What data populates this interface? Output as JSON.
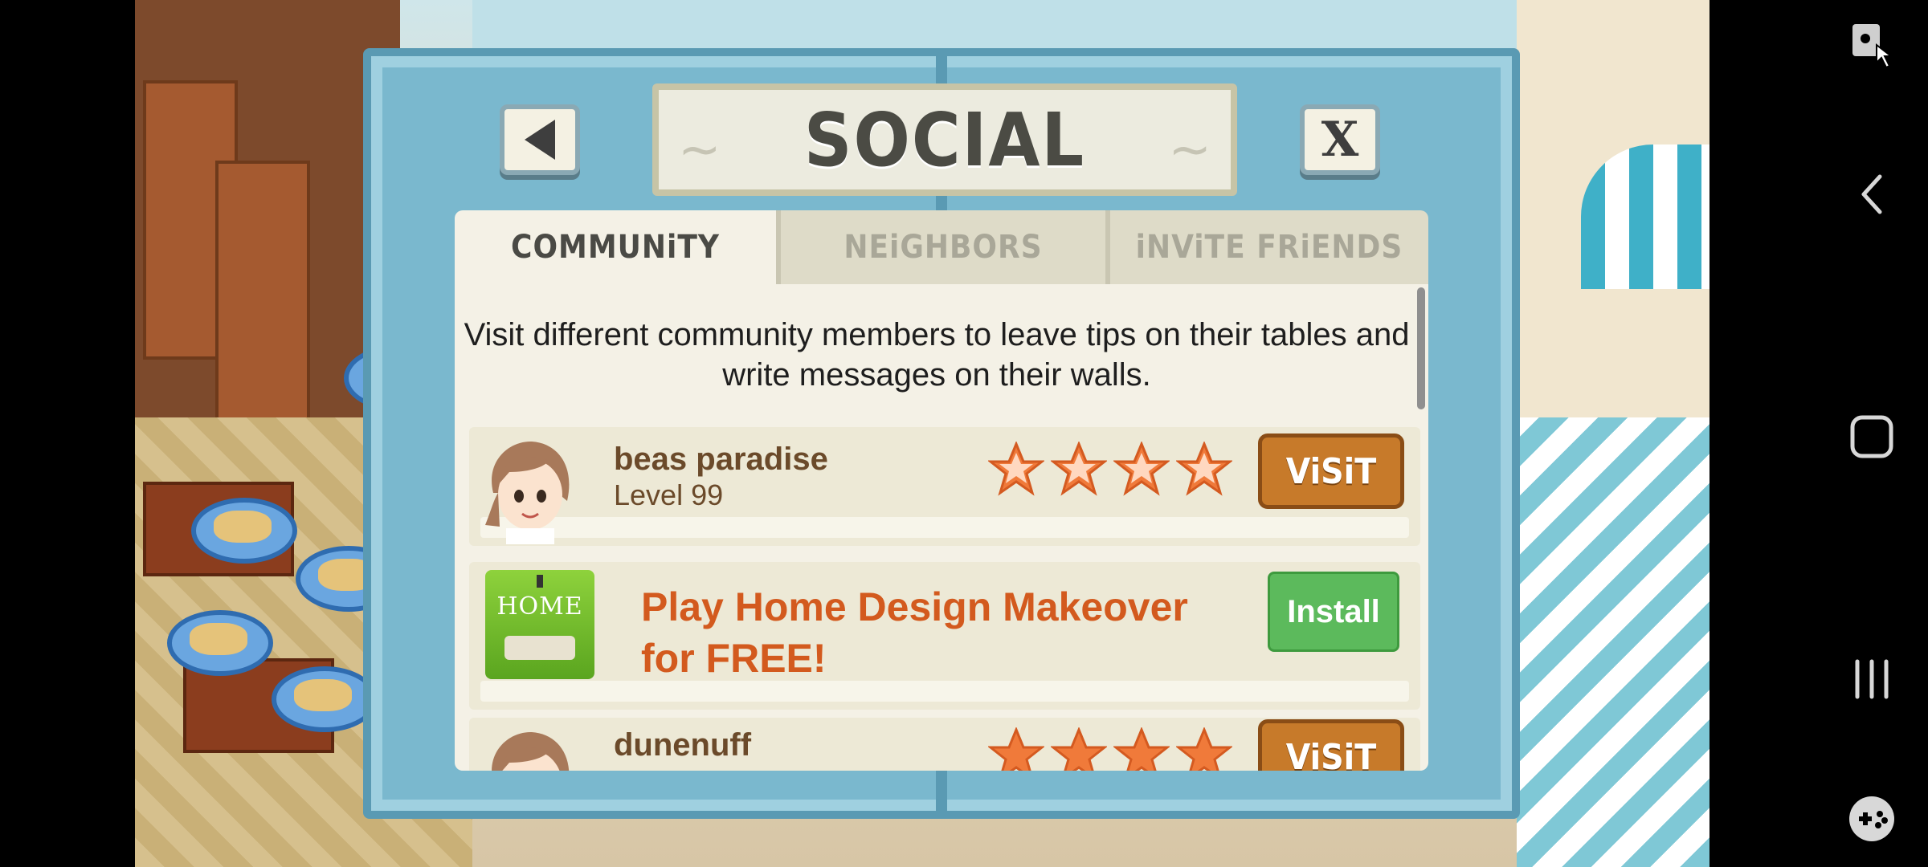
{
  "dialog": {
    "title": "SOCIAL",
    "back_icon": "triangle-left-icon",
    "close_label": "X"
  },
  "tabs": [
    {
      "label": "COMMUNiTY",
      "active": true
    },
    {
      "label": "NEiGHBORS",
      "active": false
    },
    {
      "label": "iNViTE FRiENDS",
      "active": false
    }
  ],
  "description": "Visit different community members to leave tips on their tables and write messages on their walls.",
  "members": [
    {
      "name": "beas paradise",
      "level": "Level 99",
      "stars": 4,
      "visit_label": "ViSiT"
    },
    {
      "name": "dunenuff",
      "stars": 4,
      "visit_label": "ViSiT"
    }
  ],
  "ad": {
    "logo_text": "HOME",
    "text": "Play Home Design Makeover for FREE!",
    "install_label": "Install"
  },
  "system_nav": {
    "icons": [
      "screen-lock-icon",
      "back-chevron-icon",
      "home-square-icon",
      "recents-icon",
      "game-controller-icon"
    ]
  },
  "colors": {
    "panel": "#7ab8ce",
    "visit_button": "#c77a2a",
    "install_button": "#5cba5c",
    "ad_text": "#d35a1e",
    "star": "#f07a3a"
  }
}
